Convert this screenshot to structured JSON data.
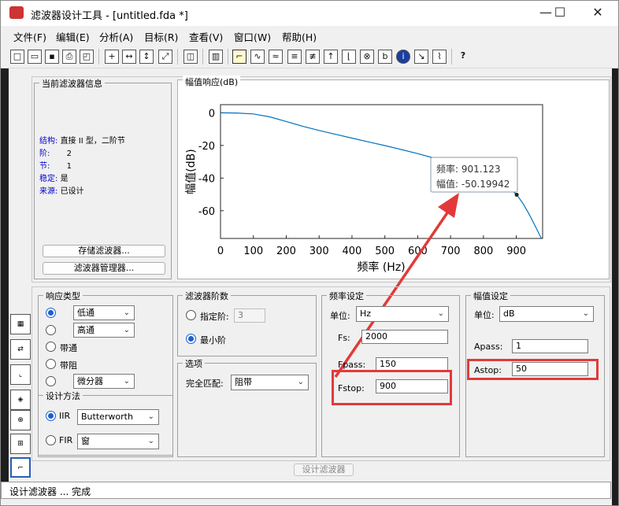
{
  "window": {
    "title": "滤波器设计工具 - [untitled.fda *]",
    "minimize": "—",
    "maximize": "☐",
    "close": "✕"
  },
  "menu": [
    "文件(F)",
    "编辑(E)",
    "分析(A)",
    "目标(R)",
    "查看(V)",
    "窗口(W)",
    "帮助(H)"
  ],
  "current_filter_info": {
    "title": "当前滤波器信息",
    "rows": [
      {
        "key": "结构:",
        "value": "直接 II 型，二阶节"
      },
      {
        "key": "阶:",
        "value": "2"
      },
      {
        "key": "节:",
        "value": "1"
      },
      {
        "key": "稳定:",
        "value": "是"
      },
      {
        "key": "来源:",
        "value": "已设计"
      }
    ],
    "store_button": "存储滤波器...",
    "manager_button": "滤波器管理器..."
  },
  "magnitude_panel": {
    "title": "幅值响应(dB)"
  },
  "chart_data": {
    "type": "line",
    "xlabel": "频率 (Hz)",
    "ylabel": "幅值(dB)",
    "xlim": [
      0,
      980
    ],
    "ylim": [
      -77,
      5
    ],
    "xticks": [
      0,
      100,
      200,
      300,
      400,
      500,
      600,
      700,
      800,
      900
    ],
    "yticks": [
      0,
      -20,
      -40,
      -60
    ],
    "grid": false,
    "series": [
      {
        "x": [
          0,
          50,
          100,
          150,
          200,
          250,
          300,
          350,
          400,
          450,
          500,
          550,
          600,
          650,
          700,
          750,
          800,
          850,
          880,
          901.123,
          920,
          940,
          960,
          980
        ],
        "y": [
          0,
          -0.1,
          -0.7,
          -2.5,
          -5.3,
          -8.2,
          -10.8,
          -13.2,
          -15.5,
          -17.8,
          -20.1,
          -22.5,
          -25.0,
          -27.8,
          -30.8,
          -34.0,
          -37.8,
          -42.3,
          -46.2,
          -50.19942,
          -55.5,
          -62.5,
          -70.5,
          -78.5
        ],
        "color": "#0072bd"
      }
    ],
    "datatip": {
      "x": 901.123,
      "y": -50.19942,
      "line1": "频率: 901.123",
      "line2": "幅值: -50.19942"
    }
  },
  "response_type": {
    "title": "响应类型",
    "options": [
      {
        "label": "低通",
        "selected": true,
        "dropdown": true
      },
      {
        "label": "高通",
        "selected": false,
        "dropdown": true
      },
      {
        "label": "带通",
        "selected": false,
        "dropdown": false
      },
      {
        "label": "带阻",
        "selected": false,
        "dropdown": false
      },
      {
        "label": "微分器",
        "selected": false,
        "dropdown": true
      }
    ]
  },
  "design_method": {
    "title": "设计方法",
    "iir_label": "IIR",
    "iir_value": "Butterworth",
    "fir_label": "FIR",
    "fir_value": "窗",
    "selected": "IIR"
  },
  "filter_order": {
    "title": "滤波器阶数",
    "specify_label": "指定阶:",
    "specify_value": "3",
    "minimum_label": "最小阶",
    "selected": "minimum"
  },
  "options": {
    "title": "选项",
    "match_label": "完全匹配:",
    "match_value": "阻带"
  },
  "freq_spec": {
    "title": "频率设定",
    "units_label": "单位:",
    "units_value": "Hz",
    "fs_label": "Fs:",
    "fs_value": "2000",
    "fpass_label": "Fpass:",
    "fpass_value": "150",
    "fstop_label": "Fstop:",
    "fstop_value": "900"
  },
  "mag_spec": {
    "title": "幅值设定",
    "units_label": "单位:",
    "units_value": "dB",
    "apass_label": "Apass:",
    "apass_value": "1",
    "astop_label": "Astop:",
    "astop_value": "50"
  },
  "design_button": "设计滤波器",
  "status": "设计滤波器 ... 完成",
  "colors": {
    "curve": "#0072bd",
    "highlight": "#e23a3a",
    "radio": "#1a5fd0"
  }
}
